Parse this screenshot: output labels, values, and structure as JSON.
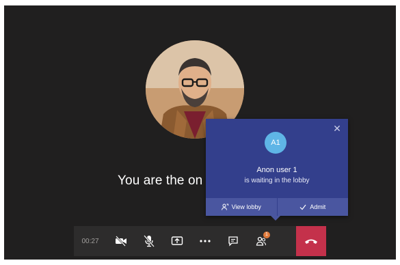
{
  "call": {
    "status_text": "You are the on",
    "timer": "00:27"
  },
  "participant": {
    "avatar": "participant-photo"
  },
  "lobby_notification": {
    "initials": "A1",
    "user_name": "Anon user 1",
    "message": "is waiting in the lobby",
    "view_lobby_label": "View lobby",
    "admit_label": "Admit",
    "close_icon": "close-icon"
  },
  "controls": {
    "video_icon": "video-off-icon",
    "mic_icon": "mic-off-icon",
    "share_icon": "share-screen-icon",
    "more_icon": "more-options-icon",
    "chat_icon": "chat-icon",
    "participants_icon": "participants-icon",
    "participants_badge": "1",
    "hangup_icon": "hang-up-icon"
  },
  "colors": {
    "stage_bg": "#201f1f",
    "toolbar_bg": "#2d2c2c",
    "notification_bg": "#333f8c",
    "notification_actions_bg": "#4a56a0",
    "initials_bg": "#5fb5e6",
    "hangup_bg": "#c4314b",
    "badge_bg": "#e07a3b"
  }
}
